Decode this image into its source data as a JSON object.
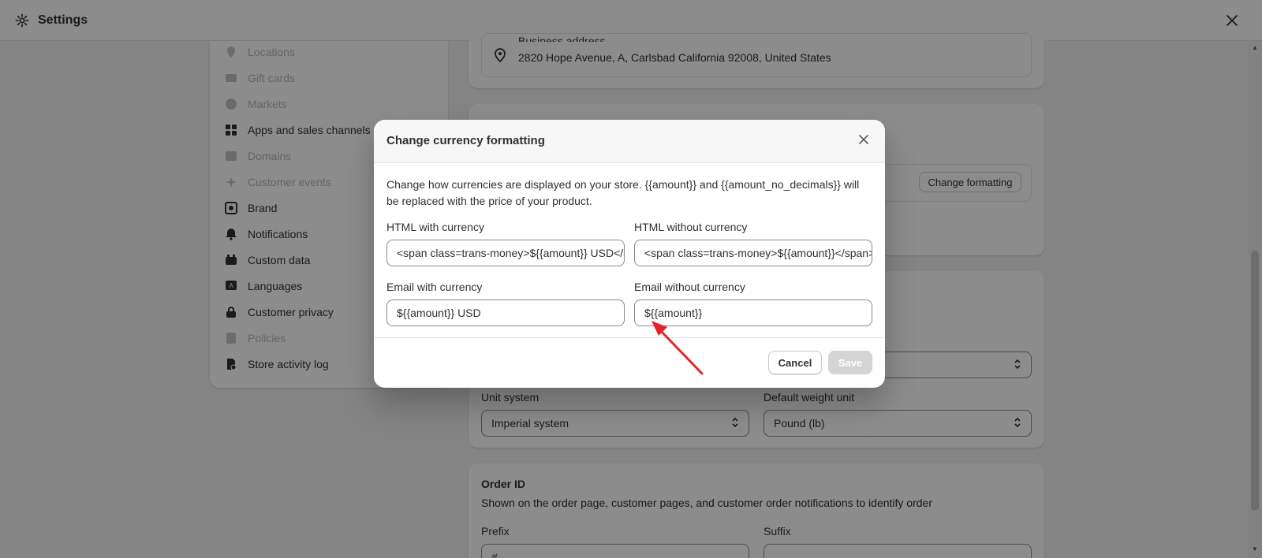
{
  "topbar": {
    "title": "Settings"
  },
  "sidebar": {
    "items": [
      {
        "label": "Locations",
        "state": "dim",
        "icon": "location-pin-icon"
      },
      {
        "label": "Gift cards",
        "state": "dim",
        "icon": "gift-card-icon"
      },
      {
        "label": "Markets",
        "state": "dim",
        "icon": "globe-icon"
      },
      {
        "label": "Apps and sales channels",
        "state": "on",
        "icon": "apps-icon"
      },
      {
        "label": "Domains",
        "state": "dim",
        "icon": "domain-icon"
      },
      {
        "label": "Customer events",
        "state": "dim",
        "icon": "sparkle-icon"
      },
      {
        "label": "Brand",
        "state": "on",
        "icon": "brand-icon"
      },
      {
        "label": "Notifications",
        "state": "on",
        "icon": "bell-icon"
      },
      {
        "label": "Custom data",
        "state": "on",
        "icon": "database-icon"
      },
      {
        "label": "Languages",
        "state": "on",
        "icon": "language-icon"
      },
      {
        "label": "Customer privacy",
        "state": "on",
        "icon": "lock-icon"
      },
      {
        "label": "Policies",
        "state": "dim",
        "icon": "policy-icon"
      },
      {
        "label": "Store activity log",
        "state": "on",
        "icon": "activity-log-icon"
      }
    ]
  },
  "main": {
    "address_label": "Business address",
    "address_value": "2820 Hope Avenue, A, Carlsbad California 92008, United States",
    "change_formatting": "Change formatting",
    "unit_system_label": "Unit system",
    "unit_system_value": "Imperial system",
    "weight_unit_label": "Default weight unit",
    "weight_unit_value": "Pound (lb)",
    "order_id_title": "Order ID",
    "order_id_desc": "Shown on the order page, customer pages, and customer order notifications to identify order",
    "prefix_label": "Prefix",
    "prefix_value": "#",
    "suffix_label": "Suffix"
  },
  "modal": {
    "title": "Change currency formatting",
    "description": "Change how currencies are displayed on your store. {{amount}} and {{amount_no_decimals}} will be replaced with the price of your product.",
    "html_with_label": "HTML with currency",
    "html_with_value": "<span class=trans-money>${{amount}} USD</span>",
    "html_without_label": "HTML without currency",
    "html_without_value": "<span class=trans-money>${{amount}}</span>",
    "email_with_label": "Email with currency",
    "email_with_value": "${{amount}} USD",
    "email_without_label": "Email without currency",
    "email_without_value": "${{amount}}",
    "cancel_label": "Cancel",
    "save_label": "Save"
  },
  "colors": {
    "annotation_arrow": "#e8212a",
    "save_disabled": "#d4d4d4",
    "text": "#303030"
  }
}
